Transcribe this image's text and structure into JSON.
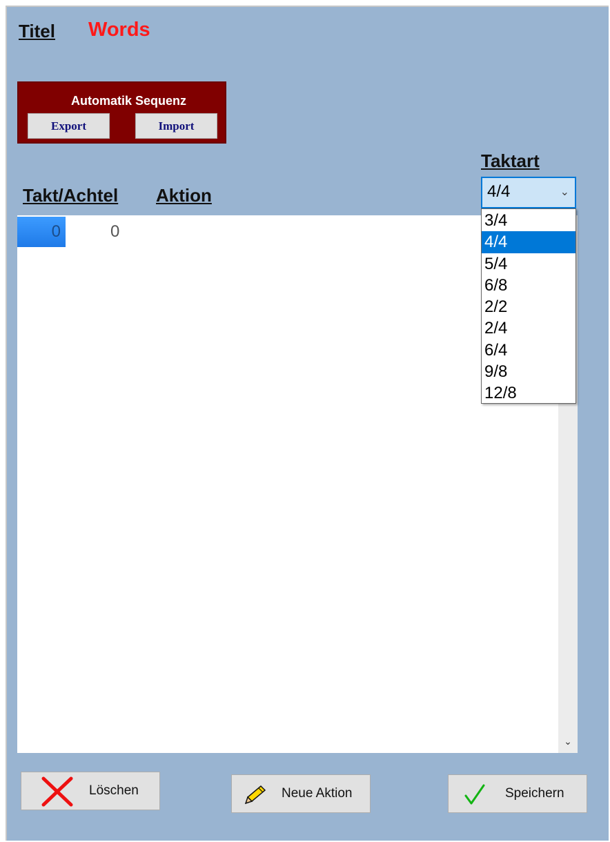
{
  "header": {
    "title_label": "Titel",
    "title_value": "Words"
  },
  "auto_sequence": {
    "title": "Automatik Sequenz",
    "export_label": "Export",
    "import_label": "Import"
  },
  "taktart": {
    "label": "Taktart",
    "selected": "4/4",
    "options": [
      "3/4",
      "4/4",
      "5/4",
      "6/8",
      "2/2",
      "2/4",
      "6/4",
      "9/8",
      "12/8"
    ],
    "highlighted_index": 1
  },
  "columns": {
    "takt_achtel": "Takt/Achtel",
    "aktion": "Aktion"
  },
  "rows": [
    {
      "takt": "0",
      "achtel": "0"
    }
  ],
  "buttons": {
    "delete_label": "Löschen",
    "new_label": "Neue Aktion",
    "save_label": "Speichern"
  },
  "icons": {
    "delete": "x-icon",
    "new": "pencil-icon",
    "save": "check-icon",
    "scroll_down": "chevron-down-icon",
    "select": "chevron-down-icon"
  },
  "colors": {
    "background": "#99b4d1",
    "title_value": "#ff1a1a",
    "panel": "#800000",
    "accent": "#0078d7"
  }
}
